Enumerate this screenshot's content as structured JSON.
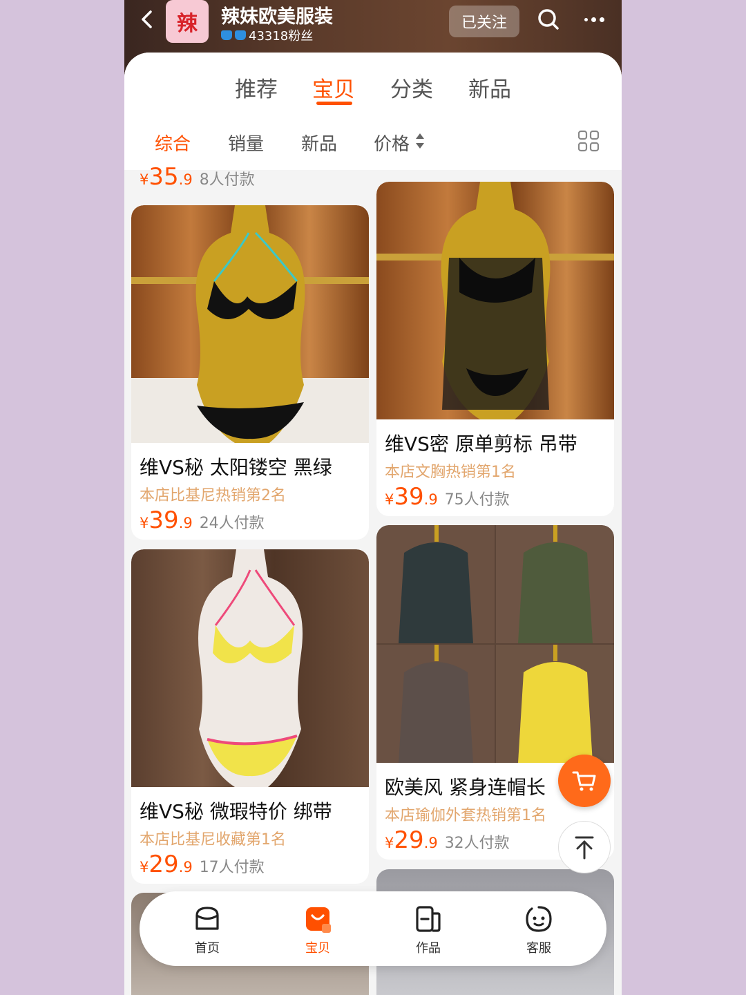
{
  "shop": {
    "avatar_char": "辣",
    "name": "辣妹欧美服装",
    "fans": "43318粉丝",
    "follow_label": "已关注"
  },
  "main_tabs": [
    {
      "label": "推荐"
    },
    {
      "label": "宝贝"
    },
    {
      "label": "分类"
    },
    {
      "label": "新品"
    }
  ],
  "sort_tabs": [
    {
      "label": "综合"
    },
    {
      "label": "销量"
    },
    {
      "label": "新品"
    },
    {
      "label": "价格"
    }
  ],
  "top_item": {
    "yen": "¥",
    "price_int": "35",
    "price_dec": ".9",
    "sales": "8人付款"
  },
  "products": [
    {
      "title": "维VS秘 太阳镂空 黑绿",
      "rank": "本店比基尼热销第2名",
      "yen": "¥",
      "price_int": "39",
      "price_dec": ".9",
      "sales": "24人付款"
    },
    {
      "title": "维VS密 原单剪标 吊带",
      "rank": "本店文胸热销第1名",
      "yen": "¥",
      "price_int": "39",
      "price_dec": ".9",
      "sales": "75人付款"
    },
    {
      "title": "维VS秘 微瑕特价 绑带",
      "rank": "本店比基尼收藏第1名",
      "yen": "¥",
      "price_int": "29",
      "price_dec": ".9",
      "sales": "17人付款"
    },
    {
      "title": "欧美风 紧身连帽长",
      "rank": "本店瑜伽外套热销第1名",
      "yen": "¥",
      "price_int": "29",
      "price_dec": ".9",
      "sales": "32人付款"
    }
  ],
  "bottom_nav": [
    {
      "label": "首页"
    },
    {
      "label": "宝贝"
    },
    {
      "label": "作品"
    },
    {
      "label": "客服"
    }
  ],
  "colors": {
    "accent": "#ff5000",
    "rank": "#e2a66d"
  }
}
